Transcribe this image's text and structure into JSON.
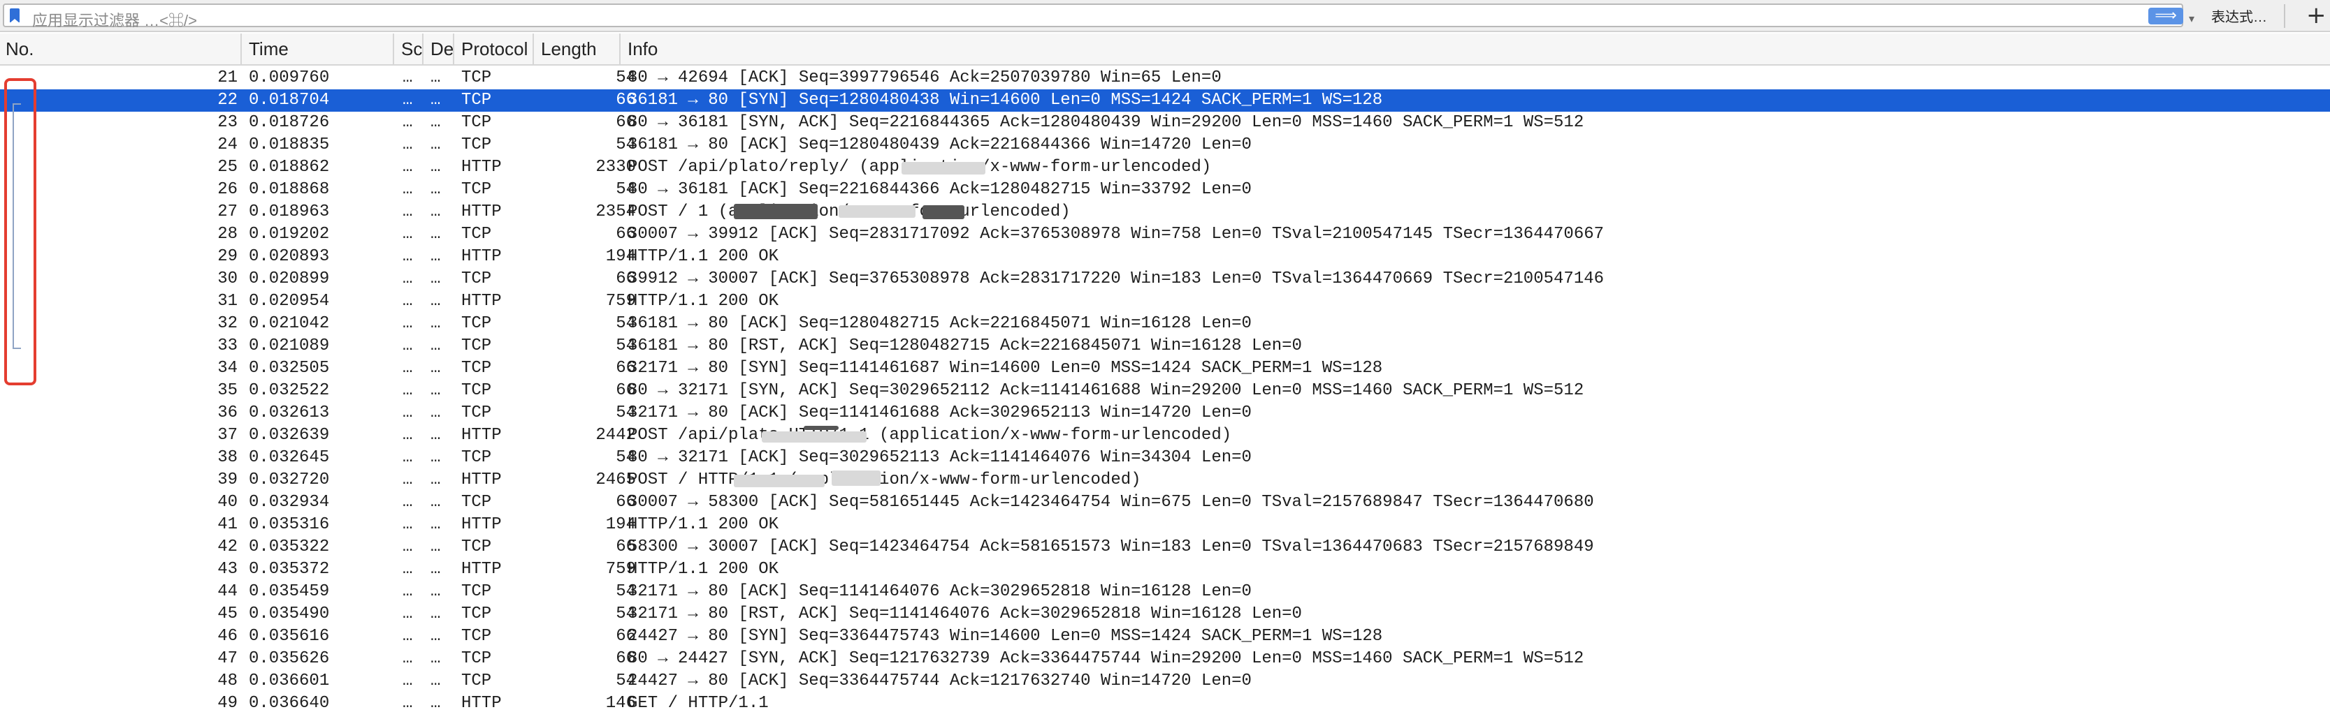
{
  "filter": {
    "placeholder": "应用显示过滤器 …<⌘/>",
    "apply_icon": "arrow-right-icon",
    "apply_glyph": "⟹",
    "dropdown_glyph": "▾",
    "expression_label": "表达式…",
    "add_glyph": "+"
  },
  "columns": {
    "no": "No.",
    "time": "Time",
    "source": "Sc",
    "destination": "De",
    "protocol": "Protocol",
    "length": "Length",
    "info": "Info"
  },
  "selected_color": "#1a5fd6",
  "highlight_color": "#e43d30",
  "packets": [
    {
      "no": "21",
      "time": "0.009760",
      "src": "…",
      "dst": "…",
      "proto": "TCP",
      "len": "54",
      "info": "80 → 42694 [ACK] Seq=3997796546 Ack=2507039780 Win=65 Len=0"
    },
    {
      "no": "22",
      "time": "0.018704",
      "src": "…",
      "dst": "…",
      "proto": "TCP",
      "len": "66",
      "info": "36181 → 80 [SYN] Seq=1280480438 Win=14600 Len=0 MSS=1424 SACK_PERM=1 WS=128"
    },
    {
      "no": "23",
      "time": "0.018726",
      "src": "…",
      "dst": "…",
      "proto": "TCP",
      "len": "66",
      "info": "80 → 36181 [SYN, ACK] Seq=2216844365 Ack=1280480439 Win=29200 Len=0 MSS=1460 SACK_PERM=1 WS=512"
    },
    {
      "no": "24",
      "time": "0.018835",
      "src": "…",
      "dst": "…",
      "proto": "TCP",
      "len": "54",
      "info": "36181 → 80 [ACK] Seq=1280480439 Ack=2216844366 Win=14720 Len=0"
    },
    {
      "no": "25",
      "time": "0.018862",
      "src": "…",
      "dst": "…",
      "proto": "HTTP",
      "len": "2330",
      "info": "POST /api/plato/reply/            (application/x-www-form-urlencoded)"
    },
    {
      "no": "26",
      "time": "0.018868",
      "src": "…",
      "dst": "…",
      "proto": "TCP",
      "len": "54",
      "info": "80 → 36181 [ACK] Seq=2216844366 Ack=1280482715 Win=33792 Len=0"
    },
    {
      "no": "27",
      "time": "0.018963",
      "src": "…",
      "dst": "…",
      "proto": "HTTP",
      "len": "2354",
      "info": "POST /                         1  (application/x-www-form-urlencoded)"
    },
    {
      "no": "28",
      "time": "0.019202",
      "src": "…",
      "dst": "…",
      "proto": "TCP",
      "len": "66",
      "info": "30007 → 39912 [ACK] Seq=2831717092 Ack=3765308978 Win=758 Len=0 TSval=2100547145 TSecr=1364470667"
    },
    {
      "no": "29",
      "time": "0.020893",
      "src": "…",
      "dst": "…",
      "proto": "HTTP",
      "len": "194",
      "info": "HTTP/1.1 200 OK"
    },
    {
      "no": "30",
      "time": "0.020899",
      "src": "…",
      "dst": "…",
      "proto": "TCP",
      "len": "66",
      "info": "39912 → 30007 [ACK] Seq=3765308978 Ack=2831717220 Win=183 Len=0 TSval=1364470669 TSecr=2100547146"
    },
    {
      "no": "31",
      "time": "0.020954",
      "src": "…",
      "dst": "…",
      "proto": "HTTP",
      "len": "759",
      "info": "HTTP/1.1 200 OK"
    },
    {
      "no": "32",
      "time": "0.021042",
      "src": "…",
      "dst": "…",
      "proto": "TCP",
      "len": "54",
      "info": "36181 → 80 [ACK] Seq=1280482715 Ack=2216845071 Win=16128 Len=0"
    },
    {
      "no": "33",
      "time": "0.021089",
      "src": "…",
      "dst": "…",
      "proto": "TCP",
      "len": "54",
      "info": "36181 → 80 [RST, ACK] Seq=1280482715 Ack=2216845071 Win=16128 Len=0"
    },
    {
      "no": "34",
      "time": "0.032505",
      "src": "…",
      "dst": "…",
      "proto": "TCP",
      "len": "66",
      "info": "32171 → 80 [SYN] Seq=1141461687 Win=14600 Len=0 MSS=1424 SACK_PERM=1 WS=128"
    },
    {
      "no": "35",
      "time": "0.032522",
      "src": "…",
      "dst": "…",
      "proto": "TCP",
      "len": "66",
      "info": "80 → 32171 [SYN, ACK] Seq=3029652112 Ack=1141461688 Win=29200 Len=0 MSS=1460 SACK_PERM=1 WS=512"
    },
    {
      "no": "36",
      "time": "0.032613",
      "src": "…",
      "dst": "…",
      "proto": "TCP",
      "len": "54",
      "info": "32171 → 80 [ACK] Seq=1141461688 Ack=3029652113 Win=14720 Len=0"
    },
    {
      "no": "37",
      "time": "0.032639",
      "src": "…",
      "dst": "…",
      "proto": "HTTP",
      "len": "2442",
      "info": "POST /api/plato               HTTP/1.1  (application/x-www-form-urlencoded)"
    },
    {
      "no": "38",
      "time": "0.032645",
      "src": "…",
      "dst": "…",
      "proto": "TCP",
      "len": "54",
      "info": "80 → 32171 [ACK] Seq=3029652113 Ack=1141464076 Win=34304 Len=0"
    },
    {
      "no": "39",
      "time": "0.032720",
      "src": "…",
      "dst": "…",
      "proto": "HTTP",
      "len": "2465",
      "info": "POST /                         HTTP/1.1  (application/x-www-form-urlencoded)"
    },
    {
      "no": "40",
      "time": "0.032934",
      "src": "…",
      "dst": "…",
      "proto": "TCP",
      "len": "66",
      "info": "30007 → 58300 [ACK] Seq=581651445 Ack=1423464754 Win=675 Len=0 TSval=2157689847 TSecr=1364470680"
    },
    {
      "no": "41",
      "time": "0.035316",
      "src": "…",
      "dst": "…",
      "proto": "HTTP",
      "len": "194",
      "info": "HTTP/1.1 200 OK"
    },
    {
      "no": "42",
      "time": "0.035322",
      "src": "…",
      "dst": "…",
      "proto": "TCP",
      "len": "66",
      "info": "58300 → 30007 [ACK] Seq=1423464754 Ack=581651573 Win=183 Len=0 TSval=1364470683 TSecr=2157689849"
    },
    {
      "no": "43",
      "time": "0.035372",
      "src": "…",
      "dst": "…",
      "proto": "HTTP",
      "len": "759",
      "info": "HTTP/1.1 200 OK"
    },
    {
      "no": "44",
      "time": "0.035459",
      "src": "…",
      "dst": "…",
      "proto": "TCP",
      "len": "54",
      "info": "32171 → 80 [ACK] Seq=1141464076 Ack=3029652818 Win=16128 Len=0"
    },
    {
      "no": "45",
      "time": "0.035490",
      "src": "…",
      "dst": "…",
      "proto": "TCP",
      "len": "54",
      "info": "32171 → 80 [RST, ACK] Seq=1141464076 Ack=3029652818 Win=16128 Len=0"
    },
    {
      "no": "46",
      "time": "0.035616",
      "src": "…",
      "dst": "…",
      "proto": "TCP",
      "len": "66",
      "info": "24427 → 80 [SYN] Seq=3364475743 Win=14600 Len=0 MSS=1424 SACK_PERM=1 WS=128"
    },
    {
      "no": "47",
      "time": "0.035626",
      "src": "…",
      "dst": "…",
      "proto": "TCP",
      "len": "66",
      "info": "80 → 24427 [SYN, ACK] Seq=1217632739 Ack=3364475744 Win=29200 Len=0 MSS=1460 SACK_PERM=1 WS=512"
    },
    {
      "no": "48",
      "time": "0.036601",
      "src": "…",
      "dst": "…",
      "proto": "TCP",
      "len": "54",
      "info": "24427 → 80 [ACK] Seq=3364475744 Ack=1217632740 Win=14720 Len=0"
    },
    {
      "no": "49",
      "time": "0.036640",
      "src": "…",
      "dst": "…",
      "proto": "HTTP",
      "len": "146",
      "info": "GET / HTTP/1.1"
    }
  ],
  "selected_row": "22"
}
